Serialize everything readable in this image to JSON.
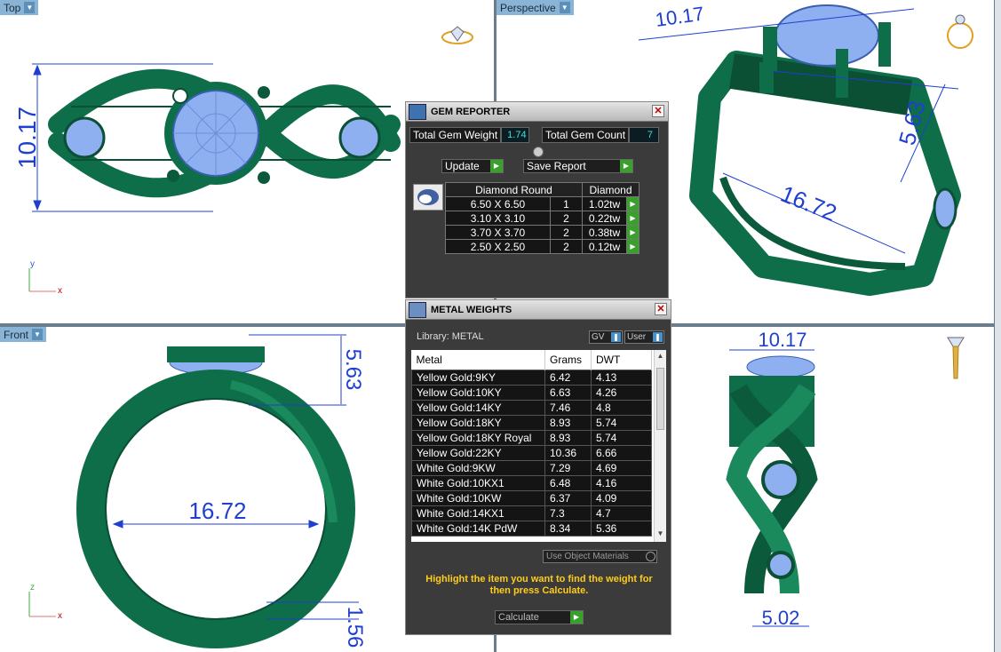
{
  "viewports": {
    "top": {
      "label": "Top",
      "dim_height": "10.17"
    },
    "perspective": {
      "label": "Perspective",
      "dim_a": "10.17",
      "dim_b": "5.63",
      "dim_c": "16.72"
    },
    "front": {
      "label": "Front",
      "dim_a": "5.63",
      "dim_b": "16.72",
      "dim_c": "1.56"
    },
    "right": {
      "dim_a": "10.17",
      "dim_b": "5.02"
    }
  },
  "axes": {
    "top_x": "x",
    "top_y": "y",
    "front_x": "x",
    "front_z": "z"
  },
  "gem_reporter": {
    "title": "GEM REPORTER",
    "total_weight_label": "Total Gem Weight",
    "total_weight_value": "1.74",
    "total_count_label": "Total Gem Count",
    "total_count_value": "7",
    "update_label": "Update",
    "save_report_label": "Save Report",
    "header_shape": "Diamond Round",
    "header_type": "Diamond",
    "rows": [
      {
        "size": "6.50 X 6.50",
        "count": "1",
        "weight": "1.02tw"
      },
      {
        "size": "3.10 X 3.10",
        "count": "2",
        "weight": "0.22tw"
      },
      {
        "size": "3.70 X 3.70",
        "count": "2",
        "weight": "0.38tw"
      },
      {
        "size": "2.50 X 2.50",
        "count": "2",
        "weight": "0.12tw"
      }
    ]
  },
  "metal_weights": {
    "title": "METAL WEIGHTS",
    "library_label": "Library: METAL",
    "gv_label": "GV",
    "user_label": "User",
    "col_metal": "Metal",
    "col_grams": "Grams",
    "col_dwt": "DWT",
    "rows": [
      {
        "metal": "Yellow Gold:9KY",
        "grams": "6.42",
        "dwt": "4.13"
      },
      {
        "metal": "Yellow Gold:10KY",
        "grams": "6.63",
        "dwt": "4.26"
      },
      {
        "metal": "Yellow Gold:14KY",
        "grams": "7.46",
        "dwt": "4.8"
      },
      {
        "metal": "Yellow Gold:18KY",
        "grams": "8.93",
        "dwt": "5.74"
      },
      {
        "metal": "Yellow Gold:18KY Royal",
        "grams": "8.93",
        "dwt": "5.74"
      },
      {
        "metal": "Yellow Gold:22KY",
        "grams": "10.36",
        "dwt": "6.66"
      },
      {
        "metal": "White Gold:9KW",
        "grams": "7.29",
        "dwt": "4.69"
      },
      {
        "metal": "White Gold:10KX1",
        "grams": "6.48",
        "dwt": "4.16"
      },
      {
        "metal": "White Gold:10KW",
        "grams": "6.37",
        "dwt": "4.09"
      },
      {
        "metal": "White Gold:14KX1",
        "grams": "7.3",
        "dwt": "4.7"
      },
      {
        "metal": "White Gold:14K PdW",
        "grams": "8.34",
        "dwt": "5.36"
      }
    ],
    "use_object_materials_label": "Use Object Materials",
    "hint": "Highlight the item you want to find the weight for then press Calculate.",
    "calculate_label": "Calculate"
  },
  "colors": {
    "ring_green": "#0f6e4a",
    "gem_blue": "#8fb0f0",
    "dim_blue": "#1f3fd0",
    "accent_green": "#3aa02c"
  },
  "icons": [
    "dropdown-icon",
    "close-icon",
    "ring-preview-icon",
    "gem-reporter-icon",
    "metal-weights-icon",
    "play-arrow-icon"
  ]
}
